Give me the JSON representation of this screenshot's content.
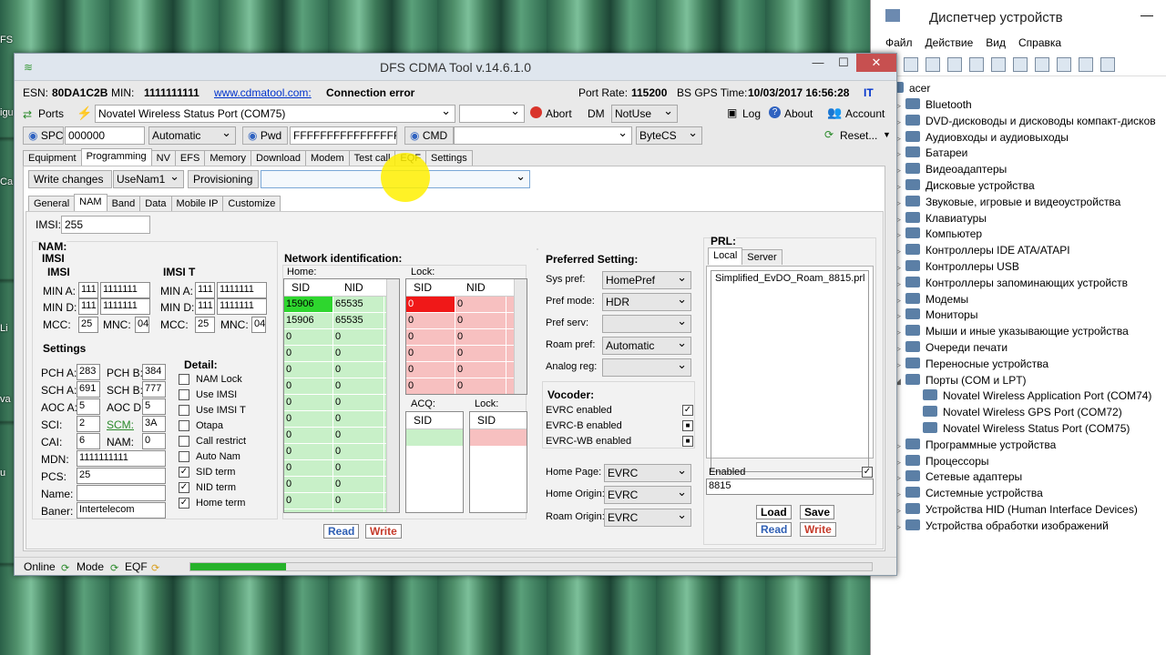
{
  "desktop": {
    "left_labels": [
      "FS",
      "igu",
      "Ca",
      "Li",
      "va",
      "u"
    ]
  },
  "window": {
    "title": "DFS CDMA Tool v.14.6.1.0",
    "minimize": "—",
    "maximize": "☐",
    "close": "✕"
  },
  "info": {
    "esn_label": "ESN:",
    "esn": "80DA1C2B",
    "min_label": "MIN:",
    "min": "1111111111",
    "link": "www.cdmatool.com:",
    "status": "Connection error",
    "port_rate_label": "Port Rate:",
    "port_rate": "115200",
    "bs_gps_label": "BS GPS Time:",
    "bs_gps": "10/03/2017 16:56:28",
    "it": "IT"
  },
  "row2": {
    "ports": "Ports",
    "port_value": "Novatel Wireless Status Port (COM75)",
    "abort": "Abort",
    "dm": "DM",
    "dm_value": "NotUse",
    "log": "Log",
    "about": "About",
    "account": "Account"
  },
  "row3": {
    "spc": "SPC",
    "spc_value": "000000",
    "spc_mode": "Automatic",
    "pwd": "Pwd",
    "pwd_value": "FFFFFFFFFFFFFFFF",
    "cmd": "CMD",
    "bytecs": "ByteCS",
    "reset": "Reset..."
  },
  "main_tabs": [
    "Equipment",
    "Programming",
    "NV",
    "EFS",
    "Memory",
    "Download",
    "Modem",
    "Test call",
    "EQF",
    "Settings"
  ],
  "prog_bar": {
    "write_changes": "Write changes",
    "nam_sel": "UseNam1",
    "provisioning": "Provisioning"
  },
  "sub_tabs": [
    "General",
    "NAM",
    "Band",
    "Data",
    "Mobile IP",
    "Customize"
  ],
  "imsi": {
    "label": "IMSI:",
    "value": "255"
  },
  "nam": {
    "title": "NAM:",
    "imsi_title": "IMSI",
    "imsi_group": "IMSI",
    "imsi_t": "IMSI T",
    "min_a": "MIN A:",
    "min_d": "MIN D:",
    "mcc": "MCC:",
    "mnc": "MNC:",
    "imsi_min_a_1": "111",
    "imsi_min_a_2": "1111111",
    "imsi_min_d_1": "111",
    "imsi_min_d_2": "1111111",
    "imsi_mcc": "25",
    "imsi_mnc": "04",
    "t_min_a_1": "111",
    "t_min_a_2": "1111111",
    "t_min_d_1": "111",
    "t_min_d_2": "1111111",
    "t_mcc": "25",
    "t_mnc": "04"
  },
  "settings": {
    "title": "Settings",
    "pch_a": "PCH A:",
    "pch_a_v": "283",
    "pch_b": "PCH B:",
    "pch_b_v": "384",
    "sch_a": "SCH A:",
    "sch_a_v": "691",
    "sch_b": "SCH B:",
    "sch_b_v": "777",
    "aoc_a": "AOC A:",
    "aoc_a_v": "5",
    "aoc_b": "AOC D:",
    "aoc_b_v": "5",
    "sci": "SCI:",
    "sci_v": "2",
    "scm": "SCM:",
    "scm_v": "3A",
    "cai": "CAI:",
    "cai_v": "6",
    "nam": "NAM:",
    "nam_v": "0",
    "mdn": "MDN:",
    "mdn_v": "1111111111",
    "pcs": "PCS:",
    "pcs_v": "25",
    "name": "Name:",
    "name_v": "",
    "baner": "Baner:",
    "baner_v": "Intertelecom"
  },
  "detail": {
    "title": "Detail:",
    "items": [
      {
        "label": "NAM Lock",
        "checked": ""
      },
      {
        "label": "Use IMSI",
        "checked": ""
      },
      {
        "label": "Use IMSI T",
        "checked": ""
      },
      {
        "label": "Otapa",
        "checked": ""
      },
      {
        "label": "Call restrict",
        "checked": ""
      },
      {
        "label": "Auto Nam",
        "checked": ""
      },
      {
        "label": "SID term",
        "checked": "✓"
      },
      {
        "label": "NID term",
        "checked": "✓"
      },
      {
        "label": "Home term",
        "checked": "✓"
      }
    ]
  },
  "netid": {
    "title": "Network identification:",
    "home": "Home:",
    "lock": "Lock:",
    "acq": "ACQ:",
    "lock2": "Lock:",
    "sid": "SID",
    "nid": "NID",
    "home_rows": [
      [
        "15906",
        "65535"
      ],
      [
        "15906",
        "65535"
      ],
      [
        "0",
        "0"
      ],
      [
        "0",
        "0"
      ],
      [
        "0",
        "0"
      ],
      [
        "0",
        "0"
      ],
      [
        "0",
        "0"
      ],
      [
        "0",
        "0"
      ],
      [
        "0",
        "0"
      ],
      [
        "0",
        "0"
      ],
      [
        "0",
        "0"
      ],
      [
        "0",
        "0"
      ],
      [
        "0",
        "0"
      ],
      [
        "0",
        "0"
      ]
    ],
    "lock_rows": [
      [
        "0",
        "0"
      ],
      [
        "0",
        "0"
      ],
      [
        "0",
        "0"
      ],
      [
        "0",
        "0"
      ],
      [
        "0",
        "0"
      ],
      [
        "0",
        "0"
      ],
      [
        "0",
        "0"
      ]
    ],
    "read": "Read",
    "write": "Write"
  },
  "pref": {
    "title": "Preferred Setting:",
    "sys_pref": "Sys pref:",
    "sys_pref_v": "HomePref",
    "pref_mode": "Pref mode:",
    "pref_mode_v": "HDR",
    "pref_serv": "Pref serv:",
    "pref_serv_v": "",
    "roam_pref": "Roam pref:",
    "roam_pref_v": "Automatic",
    "analog_reg": "Analog reg:",
    "analog_reg_v": "",
    "vocoder": "Vocoder:",
    "evrc": "EVRC enabled",
    "evrc_c": "✓",
    "evrcb": "EVRC-B enabled",
    "evrcb_c": "■",
    "evrcwb": "EVRC-WB enabled",
    "evrcwb_c": "■",
    "home_page": "Home Page:",
    "home_page_v": "EVRC",
    "home_origin": "Home Origin:",
    "home_origin_v": "EVRC",
    "roam_origin": "Roam Origin:",
    "roam_origin_v": "EVRC"
  },
  "prl": {
    "title": "PRL:",
    "tab_local": "Local",
    "tab_server": "Server",
    "file": "Simplified_EvDO_Roam_8815.prl",
    "enabled": "Enabled",
    "enabled_c": "✓",
    "version": "8815",
    "load": "Load",
    "save": "Save",
    "read": "Read",
    "write": "Write"
  },
  "status": {
    "online": "Online",
    "mode": "Mode",
    "eqf": "EQF",
    "progress": 0.14
  },
  "devmgr": {
    "title": "Диспетчер устройств",
    "menu": [
      "Файл",
      "Действие",
      "Вид",
      "Справка"
    ],
    "root": "acer",
    "items": [
      {
        "t": "Bluetooth",
        "lvl": 1,
        "ar": "▷"
      },
      {
        "t": "DVD-дисководы и дисководы компакт-дисков",
        "lvl": 1,
        "ar": "▷"
      },
      {
        "t": "Аудиовходы и аудиовыходы",
        "lvl": 1,
        "ar": "▷"
      },
      {
        "t": "Батареи",
        "lvl": 1,
        "ar": "▷"
      },
      {
        "t": "Видеоадаптеры",
        "lvl": 1,
        "ar": "▷"
      },
      {
        "t": "Дисковые устройства",
        "lvl": 1,
        "ar": "▷"
      },
      {
        "t": "Звуковые, игровые и видеоустройства",
        "lvl": 1,
        "ar": "▷"
      },
      {
        "t": "Клавиатуры",
        "lvl": 1,
        "ar": "▷"
      },
      {
        "t": "Компьютер",
        "lvl": 1,
        "ar": "▷"
      },
      {
        "t": "Контроллеры IDE ATA/ATAPI",
        "lvl": 1,
        "ar": "▷"
      },
      {
        "t": "Контроллеры USB",
        "lvl": 1,
        "ar": "▷"
      },
      {
        "t": "Контроллеры запоминающих устройств",
        "lvl": 1,
        "ar": "▷"
      },
      {
        "t": "Модемы",
        "lvl": 1,
        "ar": "▷"
      },
      {
        "t": "Мониторы",
        "lvl": 1,
        "ar": "▷"
      },
      {
        "t": "Мыши и иные указывающие устройства",
        "lvl": 1,
        "ar": "▷"
      },
      {
        "t": "Очереди печати",
        "lvl": 1,
        "ar": "▷"
      },
      {
        "t": "Переносные устройства",
        "lvl": 1,
        "ar": "▷"
      },
      {
        "t": "Порты (COM и LPT)",
        "lvl": 1,
        "ar": "◢"
      },
      {
        "t": "Novatel Wireless Application Port (COM74)",
        "lvl": 2,
        "ar": ""
      },
      {
        "t": "Novatel Wireless GPS Port (COM72)",
        "lvl": 2,
        "ar": ""
      },
      {
        "t": "Novatel Wireless Status Port (COM75)",
        "lvl": 2,
        "ar": ""
      },
      {
        "t": "Программные устройства",
        "lvl": 1,
        "ar": "▷"
      },
      {
        "t": "Процессоры",
        "lvl": 1,
        "ar": "▷"
      },
      {
        "t": "Сетевые адаптеры",
        "lvl": 1,
        "ar": "▷"
      },
      {
        "t": "Системные устройства",
        "lvl": 1,
        "ar": "▷"
      },
      {
        "t": "Устройства HID (Human Interface Devices)",
        "lvl": 1,
        "ar": "▷"
      },
      {
        "t": "Устройства обработки изображений",
        "lvl": 1,
        "ar": "▷"
      }
    ]
  }
}
